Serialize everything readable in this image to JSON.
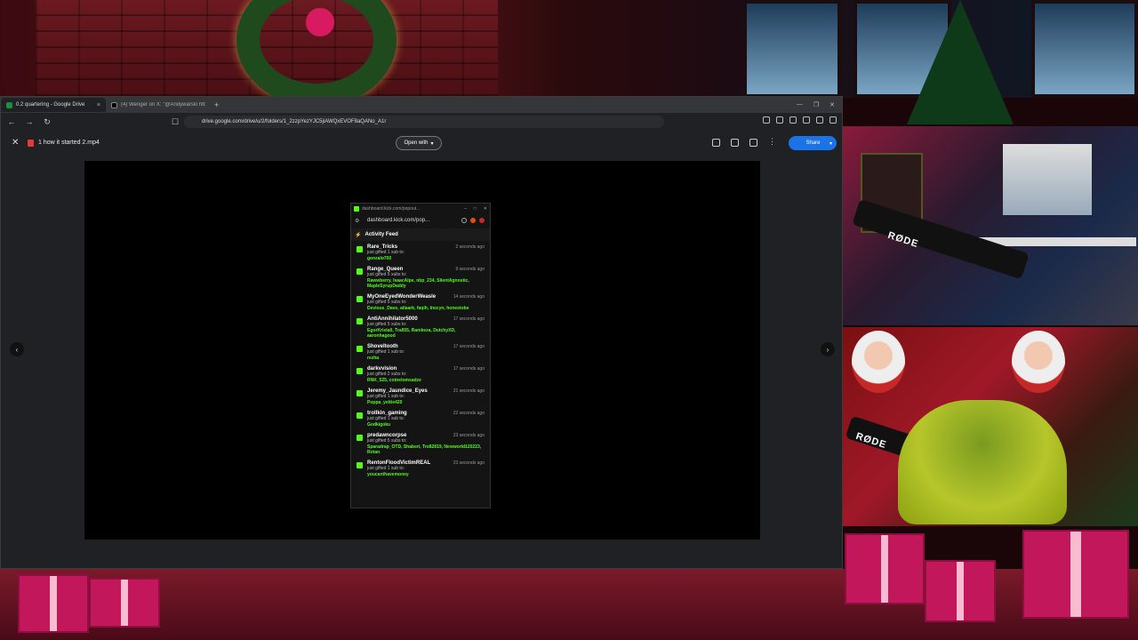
{
  "browser": {
    "tabs": [
      {
        "label": "0.2 quartering - Google Drive",
        "active": true
      },
      {
        "label": "(4) Wenger on X: \"@Andywarski http…",
        "active": false
      }
    ],
    "new_tab": "+",
    "url": "drive.google.com/drive/u/2/folders/1_2zzpYezYJC5jiAWQxEVOF8aQANo_A1r"
  },
  "drive": {
    "file_name": "1 how it started 2.mp4",
    "open_with_label": "Open with",
    "share_label": "Share"
  },
  "popout": {
    "window_title": "dashboard.kick.com/popout...",
    "url": "dashboard.kick.com/pop...",
    "feed_title": "Activity Feed",
    "items": [
      {
        "user": "Rare_Tricks",
        "time": "2 seconds ago",
        "action": "just gifted 1 sub to:",
        "recipients": "gonzalo700"
      },
      {
        "user": "Range_Queen",
        "time": "9 seconds ago",
        "action": "just gifted 5 subs to:",
        "recipients": "Rawwberry, IsaacAlpe, nbp_234, SilentAgnostic, MapleSyrupDaddy"
      },
      {
        "user": "MyOneEyedWonderWeasle",
        "time": "14 seconds ago",
        "action": "just gifted 5 subs to:",
        "recipients": "Devious_Dave, atlaark, faqih, Inscyn, honestobe"
      },
      {
        "user": "AntiAnnihilator5000",
        "time": "17 seconds ago",
        "action": "just gifted 5 subs to:",
        "recipients": "EgorKristall, Trall55, Ramkeza, DutchyXD, aaronhagood"
      },
      {
        "user": "Shoveltooth",
        "time": "17 seconds ago",
        "action": "just gifted 1 sub to:",
        "recipients": "rezha"
      },
      {
        "user": "darkvvision",
        "time": "17 seconds ago",
        "action": "just gifted 2 subs to:",
        "recipients": "RNK_525, cotnelomsadze"
      },
      {
        "user": "Jeremy_Jaundice_Eyes",
        "time": "21 seconds ago",
        "action": "just gifted 1 sub to:",
        "recipients": "Poppa_yettie420"
      },
      {
        "user": "trollkin_gaming",
        "time": "22 seconds ago",
        "action": "just gifted 1 sub to:",
        "recipients": "Godkigoku"
      },
      {
        "user": "predawncorpse",
        "time": "23 seconds ago",
        "action": "just gifted 5 subs to:",
        "recipients": "Sparadrap_OTD, Shaberi, Tro82819, Newworld120223, Rotan"
      },
      {
        "user": "RentonFloodVictimREAL",
        "time": "23 seconds ago",
        "action": "just gifted 1 sub to:",
        "recipients": "youcanthavemoney"
      }
    ]
  },
  "overlay": {
    "mic_brand_1": "RØDE",
    "mic_brand_2": "RØDE"
  },
  "colors": {
    "kick_green": "#53fc18",
    "share_blue": "#1a73e8"
  }
}
